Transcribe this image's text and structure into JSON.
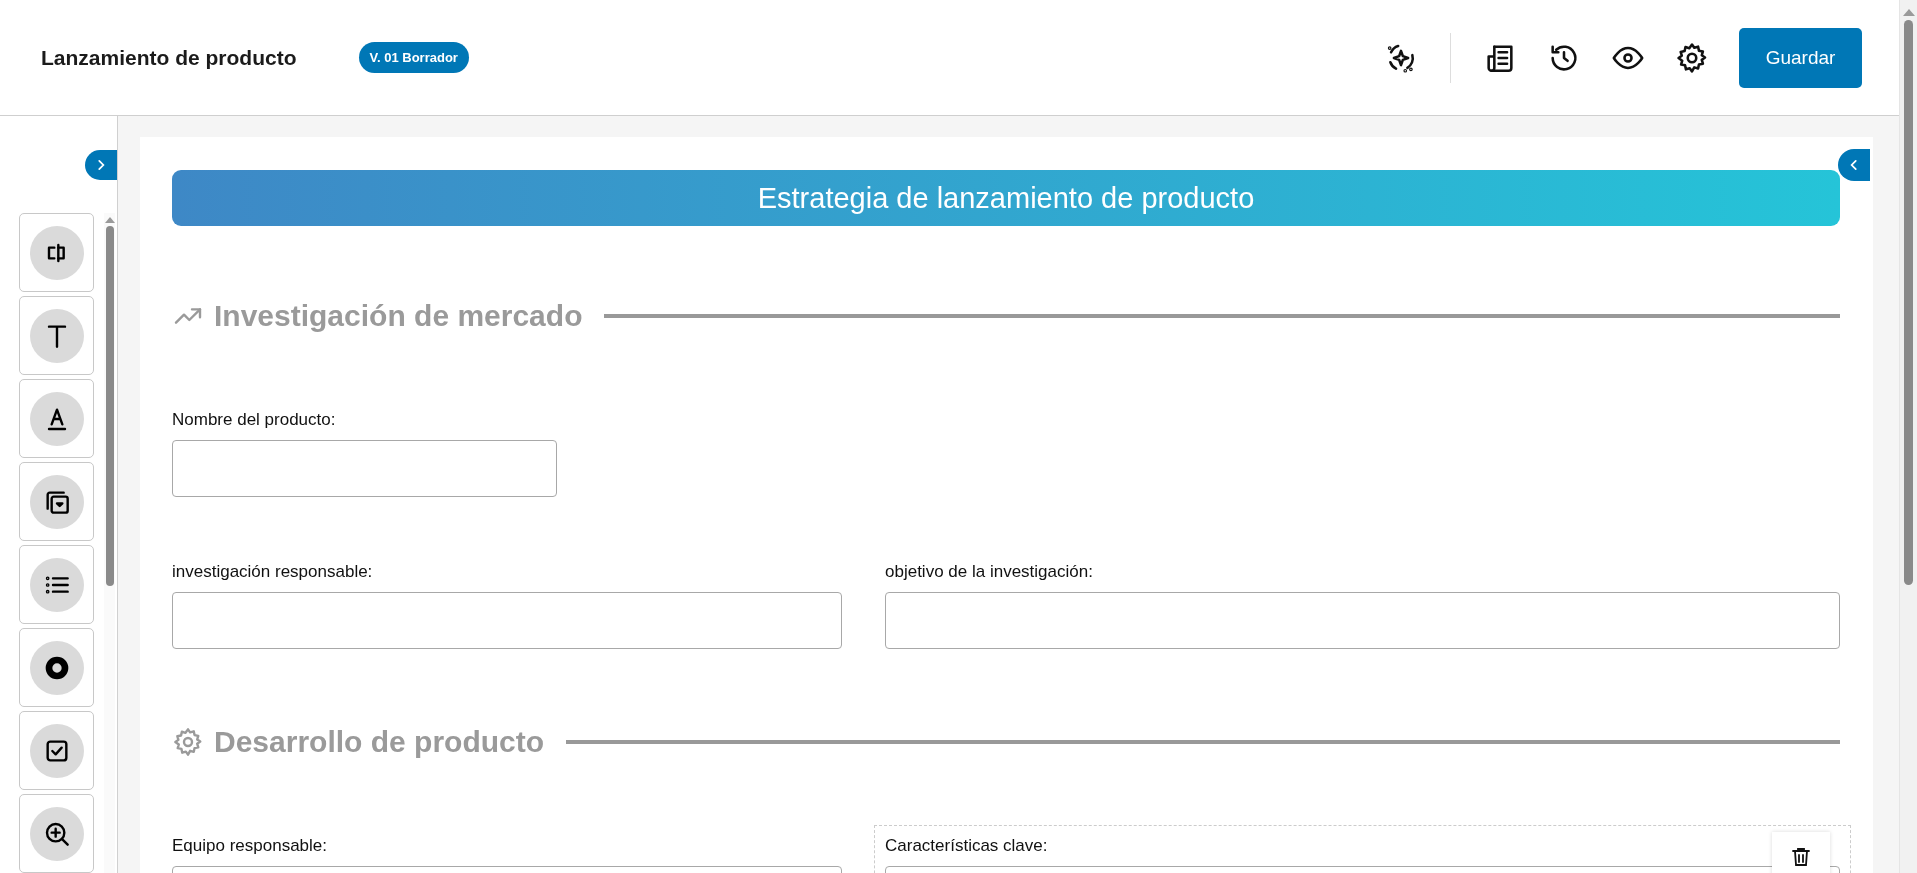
{
  "header": {
    "title": "Lanzamiento de producto",
    "badge": "V. 01 Borrador",
    "save_button": "Guardar"
  },
  "toolbar": [
    {
      "kind": "ai"
    },
    {
      "kind": "divider"
    },
    {
      "kind": "document"
    },
    {
      "kind": "history"
    },
    {
      "kind": "preview"
    },
    {
      "kind": "settings"
    }
  ],
  "tools": [
    {
      "kind": "input"
    },
    {
      "kind": "text"
    },
    {
      "kind": "label"
    },
    {
      "kind": "dropdown"
    },
    {
      "kind": "list"
    },
    {
      "kind": "radio"
    },
    {
      "kind": "checkbox"
    },
    {
      "kind": "lookup"
    }
  ],
  "form": {
    "banner": "Estrategia de lanzamiento de producto",
    "sections": [
      {
        "title": "Investigación de mercado",
        "rows": [
          [
            {
              "label": "Nombre del producto:",
              "selected": false
            }
          ],
          [
            {
              "label": "investigación responsable:",
              "selected": false
            },
            {
              "label": "objetivo de la investigación:",
              "selected": false
            }
          ]
        ]
      },
      {
        "title": "Desarrollo de producto",
        "rows": [
          [
            {
              "label": "Equipo responsable:",
              "selected": false
            },
            {
              "label": "Características clave:",
              "selected": true
            }
          ]
        ]
      }
    ]
  }
}
